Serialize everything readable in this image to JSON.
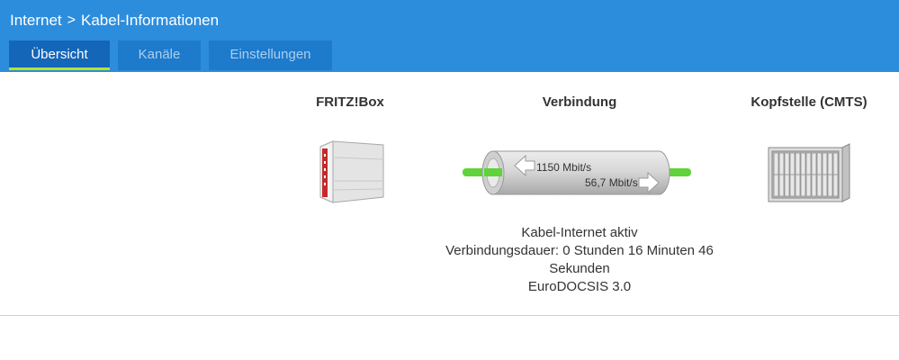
{
  "breadcrumb": {
    "parent": "Internet",
    "separator": ">",
    "current": "Kabel-Informationen"
  },
  "tabs": [
    {
      "label": "Übersicht",
      "active": true
    },
    {
      "label": "Kanäle",
      "active": false
    },
    {
      "label": "Einstellungen",
      "active": false
    }
  ],
  "columns": {
    "fritzbox_title": "FRITZ!Box",
    "connection_title": "Verbindung",
    "cmts_title": "Kopfstelle (CMTS)"
  },
  "connection": {
    "downstream": "1150 Mbit/s",
    "upstream": "56,7 Mbit/s"
  },
  "status": {
    "line1": "Kabel-Internet aktiv",
    "line2": "Verbindungsdauer: 0 Stunden 16 Minuten 46",
    "line3": "Sekunden",
    "line4": "EuroDOCSIS 3.0"
  },
  "icons": {
    "fritzbox": "router-device-icon",
    "tube": "connection-tube-icon",
    "cmts": "server-rack-icon",
    "arrow_down": "arrow-left-icon",
    "arrow_up": "arrow-right-icon"
  },
  "colors": {
    "header_bg": "#2d8ddd",
    "tab_active_bg": "#1466b9",
    "tab_inactive_bg": "#1e7acb",
    "tab_active_underline": "#b4e32b",
    "line_green": "#5fd33a",
    "text": "#333333"
  }
}
